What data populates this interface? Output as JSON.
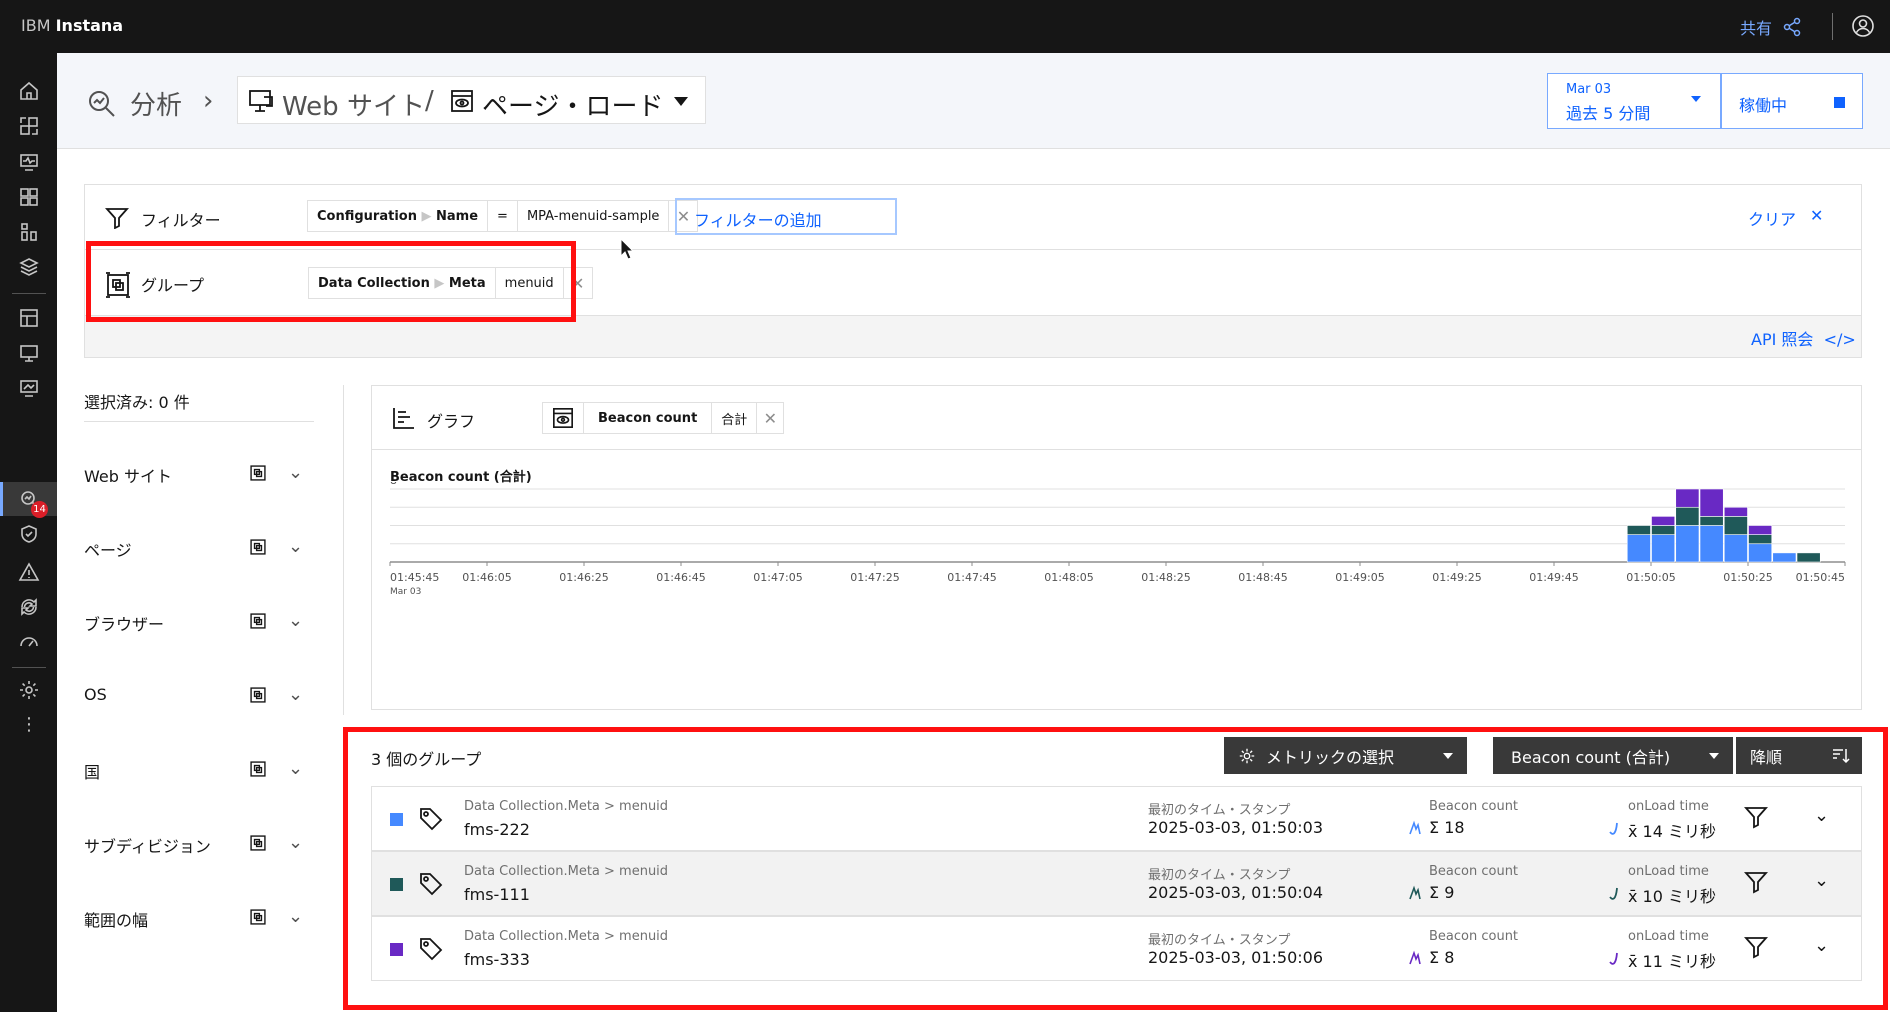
{
  "topbar": {
    "brand_prefix": "IBM",
    "brand_name": "Instana",
    "share_label": "共有"
  },
  "sidenav": {
    "alert_badge": "14"
  },
  "breadcrumb": {
    "analyze": "分析",
    "website": "Web サイト",
    "separator": "/",
    "page_load": "ページ・ロード"
  },
  "time": {
    "date": "Mar 03",
    "range": "過去 5 分間",
    "live_label": "稼働中"
  },
  "filters": {
    "filter_label": "フィルター",
    "filter_chip": {
      "key1": "Configuration",
      "key2": "Name",
      "op": "=",
      "value": "MPA-menuid-sample"
    },
    "add_filter": "フィルターの追加",
    "clear": "クリア",
    "group_label": "グループ",
    "group_chip": {
      "key1": "Data Collection",
      "key2": "Meta",
      "value": "menuid"
    },
    "api_query": "API 照会",
    "api_icon": "</>"
  },
  "facets": {
    "selected": "選択済み: 0 件",
    "items": [
      {
        "label": "Web サイト"
      },
      {
        "label": "ページ"
      },
      {
        "label": "ブラウザー"
      },
      {
        "label": "OS"
      },
      {
        "label": "国"
      },
      {
        "label": "サブディビジョン"
      },
      {
        "label": "範囲の幅"
      }
    ]
  },
  "chart": {
    "label": "グラフ",
    "metric_chip": "Beacon count",
    "agg_chip": "合計"
  },
  "chart_data": {
    "type": "bar",
    "title": "Beacon count (合計)",
    "stacked": true,
    "ylim": [
      0,
      8
    ],
    "y_ticks": [
      "8"
    ],
    "x_ticks": [
      "01:45:45",
      "01:46:05",
      "01:46:25",
      "01:46:45",
      "01:47:05",
      "01:47:25",
      "01:47:45",
      "01:48:05",
      "01:48:25",
      "01:48:45",
      "01:49:05",
      "01:49:25",
      "01:49:45",
      "01:50:05",
      "01:50:25",
      "01:50:45"
    ],
    "x_first_date": "Mar 03",
    "categories": [
      "01:50:00",
      "01:50:05",
      "01:50:10",
      "01:50:15",
      "01:50:20",
      "01:50:25",
      "01:50:30",
      "01:50:35"
    ],
    "series": [
      {
        "name": "fms-222",
        "color": "#4589ff",
        "values": [
          3,
          3,
          4,
          4,
          3,
          2,
          1,
          0
        ]
      },
      {
        "name": "fms-111",
        "color": "#1f5959",
        "values": [
          1,
          1,
          2,
          1,
          2,
          1,
          0,
          1
        ]
      },
      {
        "name": "fms-333",
        "color": "#6929c4",
        "values": [
          0,
          1,
          2,
          3,
          1,
          1,
          0,
          0
        ]
      }
    ]
  },
  "groups": {
    "count_label": "3 個のグループ",
    "metric_select": "メトリックの選択",
    "sort_metric": "Beacon count (合計)",
    "sort_order": "降順",
    "rows": [
      {
        "path": "Data Collection.Meta > menuid",
        "name": "fms-222",
        "color": "#4589ff",
        "ts_label": "最初のタイム・スタンプ",
        "ts": "2025-03-03, 01:50:03",
        "bc_label": "Beacon count",
        "bc": "Σ 18",
        "ol_label": "onLoad time",
        "ol": "x̄ 14 ミリ秒"
      },
      {
        "path": "Data Collection.Meta > menuid",
        "name": "fms-111",
        "color": "#1f5959",
        "ts_label": "最初のタイム・スタンプ",
        "ts": "2025-03-03, 01:50:04",
        "bc_label": "Beacon count",
        "bc": "Σ 9",
        "ol_label": "onLoad time",
        "ol": "x̄ 10 ミリ秒"
      },
      {
        "path": "Data Collection.Meta > menuid",
        "name": "fms-333",
        "color": "#6929c4",
        "ts_label": "最初のタイム・スタンプ",
        "ts": "2025-03-03, 01:50:06",
        "bc_label": "Beacon count",
        "bc": "Σ 8",
        "ol_label": "onLoad time",
        "ol": "x̄ 11 ミリ秒"
      }
    ]
  }
}
